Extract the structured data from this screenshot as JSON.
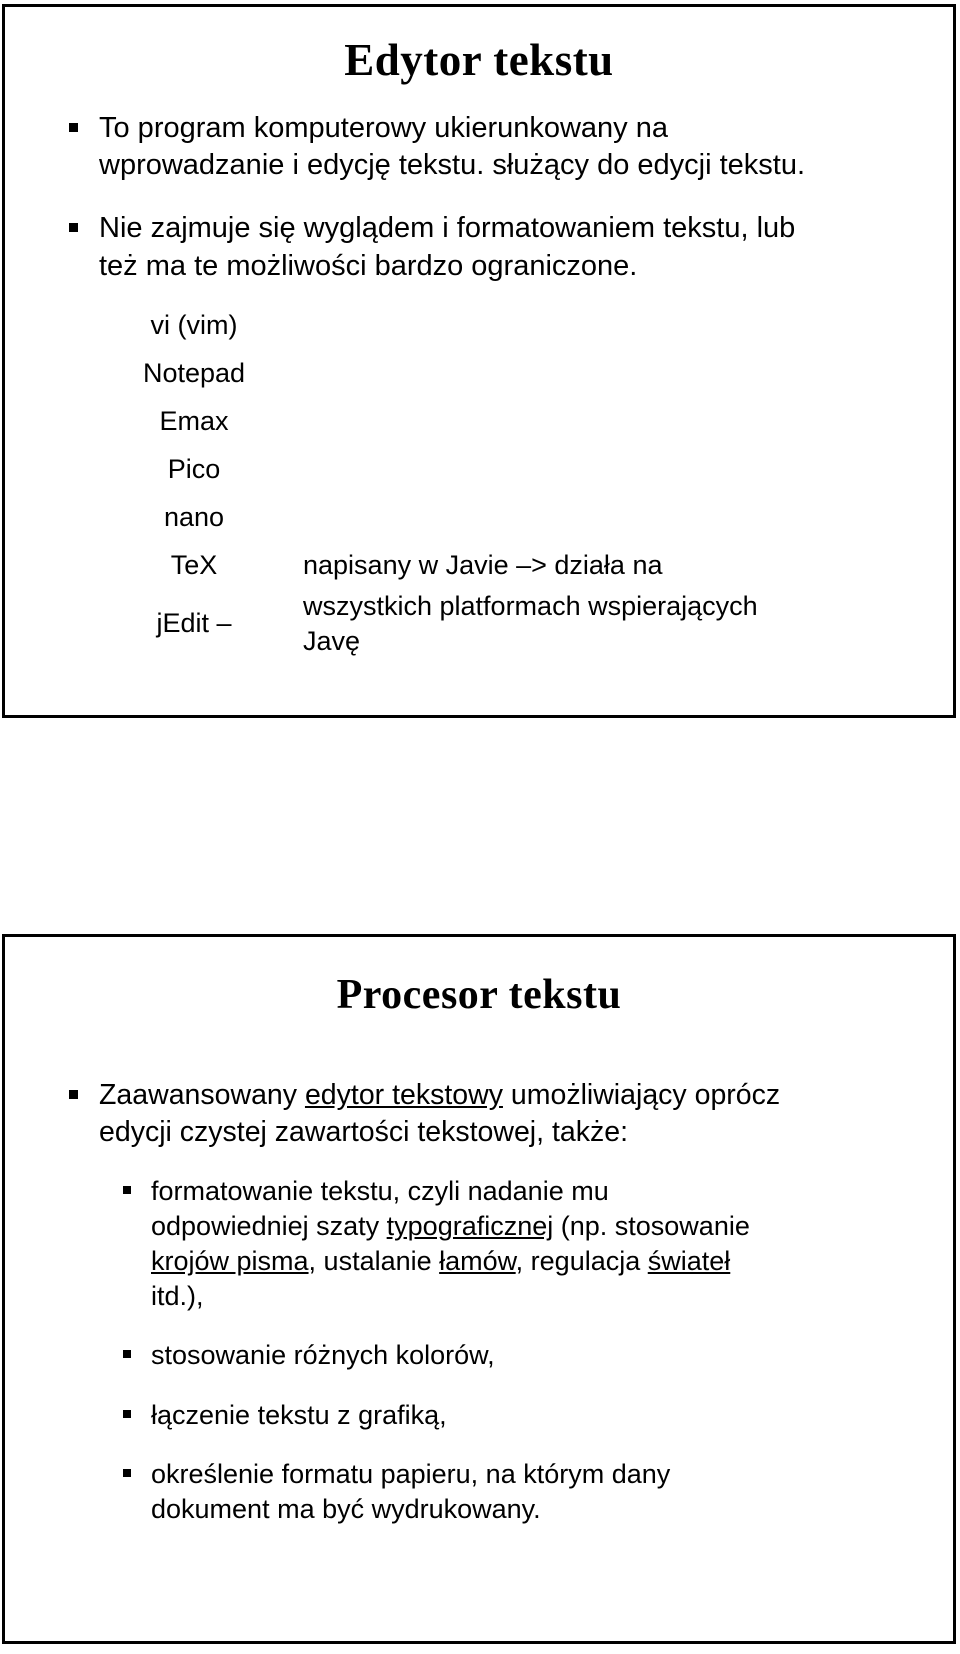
{
  "document": {
    "language": "pl",
    "slide_count": 2
  },
  "slide1": {
    "title": "Edytor tekstu",
    "bullets": [
      {
        "lines": [
          "To program komputerowy ukierunkowany na",
          "wprowadzanie i edycję tekstu. służący do edycji tekstu."
        ]
      },
      {
        "lines": [
          "Nie zajmuje się wyglądem i formatowaniem tekstu, lub",
          "też ma te możliwości bardzo ograniczone."
        ]
      }
    ],
    "editors": [
      {
        "name": "vi (vim)",
        "note": ""
      },
      {
        "name": "Notepad",
        "note": ""
      },
      {
        "name": "Emax",
        "note": ""
      },
      {
        "name": "Pico",
        "note": ""
      },
      {
        "name": "nano",
        "note": ""
      },
      {
        "name": "TeX",
        "note": ""
      },
      {
        "name": "jEdit –",
        "note": "napisany w Javie –> działa na wszystkich platformach wspierających Javę"
      }
    ],
    "jedit_note_lines": [
      "napisany w Javie –> działa na",
      "wszystkich platformach wspierających",
      "Javę"
    ]
  },
  "slide2": {
    "title": "Procesor teksu_placeholder",
    "title_text": "Procesor tekstu",
    "lead_bullet": {
      "line1_a": "Zaawansowany ",
      "line1_u": "edytor tekstowy",
      "line1_b": " umożliwiający oprócz",
      "line2": "edycji czystej zawartości tekstowej, także:"
    },
    "sub_bullets": [
      {
        "id": "formatowanie",
        "line1": "formatowanie tekstu, czyli nadanie mu",
        "line2_a": "odpowiedniej szaty ",
        "line2_u": "typograficznej",
        "line2_b": " (np. stosowanie",
        "line3_u1": "krojów pisma",
        "line3_a": ", ustalanie ",
        "line3_u2": "łamów",
        "line3_b": ", regulacja ",
        "line3_u3": "świateł",
        "line4": "itd.),"
      },
      {
        "id": "kolory",
        "line1": "stosowanie różnych kolorów,"
      },
      {
        "id": "grafika",
        "line1": "łączenie tekstu z grafiką,"
      },
      {
        "id": "papier",
        "line1": "określenie formatu papieru, na którym dany",
        "line2": "dokument ma być wydrukowany."
      }
    ]
  },
  "style": {
    "text_color": "#000000",
    "background": "#ffffff",
    "border_color": "#000000"
  }
}
